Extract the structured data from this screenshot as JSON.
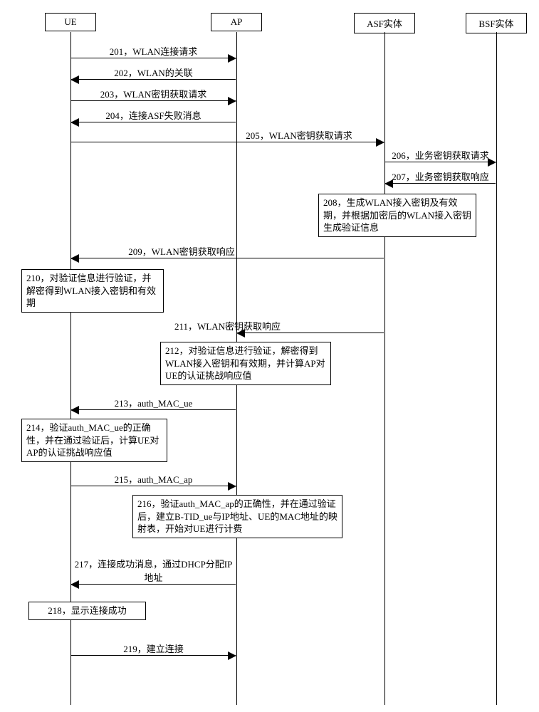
{
  "actors": {
    "ue": "UE",
    "ap": "AP",
    "asf": "ASF实体",
    "bsf": "BSF实体"
  },
  "messages": {
    "m201": "201，WLAN连接请求",
    "m202": "202，WLAN的关联",
    "m203": "203，WLAN密钥获取请求",
    "m204": "204，连接ASF失败消息",
    "m205": "205，WLAN密钥获取请求",
    "m206": "206，业务密钥获取请求",
    "m207": "207，业务密钥获取响应",
    "m208": "208，生成WLAN接入密钥及有效期，并根据加密后的WLAN接入密钥生成验证信息",
    "m209": "209，WLAN密钥获取响应",
    "m210": "210，对验证信息进行验证，并解密得到WLAN接入密钥和有效期",
    "m211": "211，WLAN密钥获取响应",
    "m212": "212，对验证信息进行验证，解密得到WLAN接入密钥和有效期，并计算AP对UE的认证挑战响应值",
    "m213": "213，auth_MAC_ue",
    "m214": "214，验证auth_MAC_ue的正确性，并在通过验证后，计算UE对AP的认证挑战响应值",
    "m215": "215，auth_MAC_ap",
    "m216": "216，验证auth_MAC_ap的正确性，并在通过验证后，建立B-TID_ue与IP地址、UE的MAC地址的映射表，开始对UE进行计费",
    "m217": "217，连接成功消息，通过DHCP分配IP地址",
    "m218": "218，显示连接成功",
    "m219": "219，建立连接"
  },
  "chart_data": {
    "type": "sequence-diagram",
    "actors": [
      "UE",
      "AP",
      "ASF实体",
      "BSF实体"
    ],
    "steps": [
      {
        "id": 201,
        "from": "UE",
        "to": "AP",
        "label": "WLAN连接请求"
      },
      {
        "id": 202,
        "from": "AP",
        "to": "UE",
        "label": "WLAN的关联"
      },
      {
        "id": 203,
        "from": "UE",
        "to": "AP",
        "label": "WLAN密钥获取请求"
      },
      {
        "id": 204,
        "from": "AP",
        "to": "UE",
        "label": "连接ASF失败消息"
      },
      {
        "id": 205,
        "from": "UE",
        "to": "ASF实体",
        "label": "WLAN密钥获取请求"
      },
      {
        "id": 206,
        "from": "ASF实体",
        "to": "BSF实体",
        "label": "业务密钥获取请求"
      },
      {
        "id": 207,
        "from": "BSF实体",
        "to": "ASF实体",
        "label": "业务密钥获取响应"
      },
      {
        "id": 208,
        "at": "ASF实体",
        "note": "生成WLAN接入密钥及有效期，并根据加密后的WLAN接入密钥生成验证信息"
      },
      {
        "id": 209,
        "from": "ASF实体",
        "to": "UE",
        "label": "WLAN密钥获取响应"
      },
      {
        "id": 210,
        "at": "UE",
        "note": "对验证信息进行验证，并解密得到WLAN接入密钥和有效期"
      },
      {
        "id": 211,
        "from": "ASF实体",
        "to": "AP",
        "label": "WLAN密钥获取响应"
      },
      {
        "id": 212,
        "at": "AP",
        "note": "对验证信息进行验证，解密得到WLAN接入密钥和有效期，并计算AP对UE的认证挑战响应值"
      },
      {
        "id": 213,
        "from": "AP",
        "to": "UE",
        "label": "auth_MAC_ue"
      },
      {
        "id": 214,
        "at": "UE",
        "note": "验证auth_MAC_ue的正确性，并在通过验证后，计算UE对AP的认证挑战响应值"
      },
      {
        "id": 215,
        "from": "UE",
        "to": "AP",
        "label": "auth_MAC_ap"
      },
      {
        "id": 216,
        "at": "AP",
        "note": "验证auth_MAC_ap的正确性，并在通过验证后，建立B-TID_ue与IP地址、UE的MAC地址的映射表，开始对UE进行计费"
      },
      {
        "id": 217,
        "from": "AP",
        "to": "UE",
        "label": "连接成功消息，通过DHCP分配IP地址"
      },
      {
        "id": 218,
        "at": "UE",
        "note": "显示连接成功"
      },
      {
        "id": 219,
        "from": "UE",
        "to": "AP",
        "label": "建立连接"
      }
    ]
  }
}
